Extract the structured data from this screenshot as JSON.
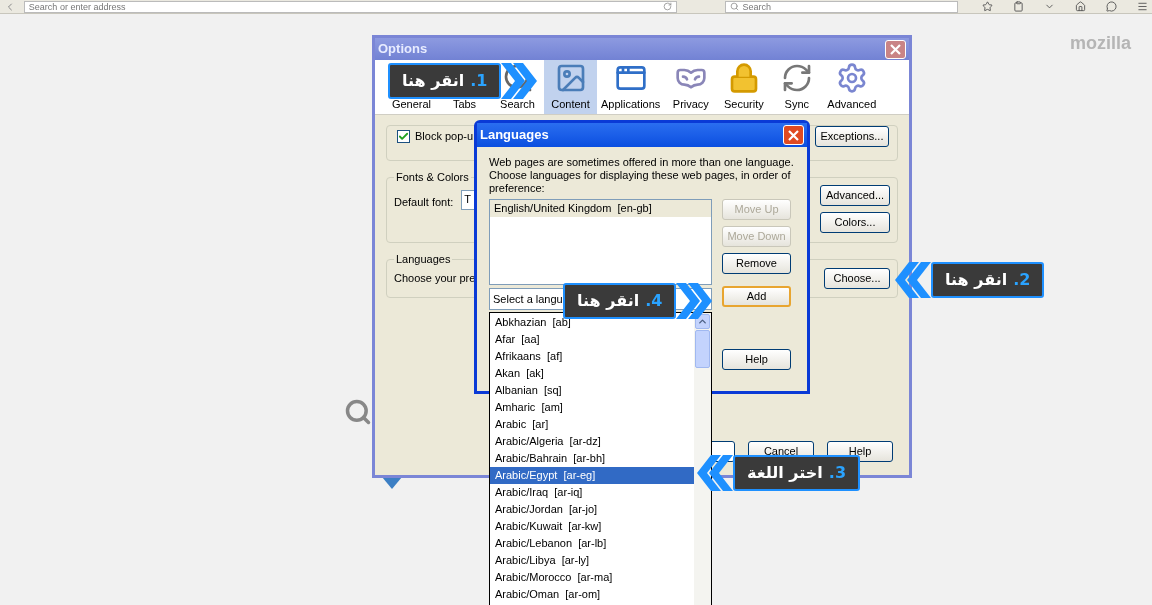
{
  "browser_toolbar": {
    "address_placeholder": "Search or enter address",
    "search_placeholder": "Search"
  },
  "brand": "mozilla",
  "options_window": {
    "title": "Options",
    "tabs": [
      {
        "label": "General",
        "kind": "general",
        "selected": false
      },
      {
        "label": "Tabs",
        "kind": "tabs",
        "selected": false
      },
      {
        "label": "Search",
        "kind": "search",
        "selected": false
      },
      {
        "label": "Content",
        "kind": "content",
        "selected": true
      },
      {
        "label": "Applications",
        "kind": "applications",
        "selected": false
      },
      {
        "label": "Privacy",
        "kind": "privacy",
        "selected": false
      },
      {
        "label": "Security",
        "kind": "security",
        "selected": false
      },
      {
        "label": "Sync",
        "kind": "sync",
        "selected": false
      },
      {
        "label": "Advanced",
        "kind": "advanced",
        "selected": false
      }
    ],
    "popups": {
      "label": "Block pop-u",
      "checked": true,
      "button": "Exceptions..."
    },
    "fonts": {
      "legend": "Fonts & Colors",
      "label": "Default font:",
      "value": "T",
      "buttons": [
        "Advanced...",
        "Colors..."
      ]
    },
    "languages": {
      "legend": "Languages",
      "text": "Choose your pre",
      "button": "Choose..."
    },
    "footer_buttons": [
      "Cancel",
      "Help"
    ]
  },
  "languages_dialog": {
    "title": "Languages",
    "description": "Web pages are sometimes offered in more than one language. Choose languages for displaying these web pages, in order of preference:",
    "languages": [
      {
        "label": "English/United Kingdom  [en-gb]",
        "selected": true
      }
    ],
    "side_buttons": [
      {
        "label": "Move Up",
        "disabled": true
      },
      {
        "label": "Move Down",
        "disabled": true
      },
      {
        "label": "Remove",
        "disabled": false
      }
    ],
    "select_placeholder": "Select a langu",
    "add_button": "Add",
    "help_button": "Help",
    "options": [
      {
        "label": "Abkhazian  [ab]",
        "selected": false
      },
      {
        "label": "Afar  [aa]",
        "selected": false
      },
      {
        "label": "Afrikaans  [af]",
        "selected": false
      },
      {
        "label": "Akan  [ak]",
        "selected": false
      },
      {
        "label": "Albanian  [sq]",
        "selected": false
      },
      {
        "label": "Amharic  [am]",
        "selected": false
      },
      {
        "label": "Arabic  [ar]",
        "selected": false
      },
      {
        "label": "Arabic/Algeria  [ar-dz]",
        "selected": false
      },
      {
        "label": "Arabic/Bahrain  [ar-bh]",
        "selected": false
      },
      {
        "label": "Arabic/Egypt  [ar-eg]",
        "selected": true
      },
      {
        "label": "Arabic/Iraq  [ar-iq]",
        "selected": false
      },
      {
        "label": "Arabic/Jordan  [ar-jo]",
        "selected": false
      },
      {
        "label": "Arabic/Kuwait  [ar-kw]",
        "selected": false
      },
      {
        "label": "Arabic/Lebanon  [ar-lb]",
        "selected": false
      },
      {
        "label": "Arabic/Libya  [ar-ly]",
        "selected": false
      },
      {
        "label": "Arabic/Morocco  [ar-ma]",
        "selected": false
      },
      {
        "label": "Arabic/Oman  [ar-om]",
        "selected": false
      }
    ]
  },
  "callouts": [
    {
      "number": "1.",
      "text": "انقر هنا",
      "kind": "right"
    },
    {
      "number": "2.",
      "text": "انقر هنا",
      "kind": "left"
    },
    {
      "number": "3.",
      "text": "اختر اللغة",
      "kind": "left"
    },
    {
      "number": "4.",
      "text": "انقر هنا",
      "kind": "right"
    }
  ]
}
